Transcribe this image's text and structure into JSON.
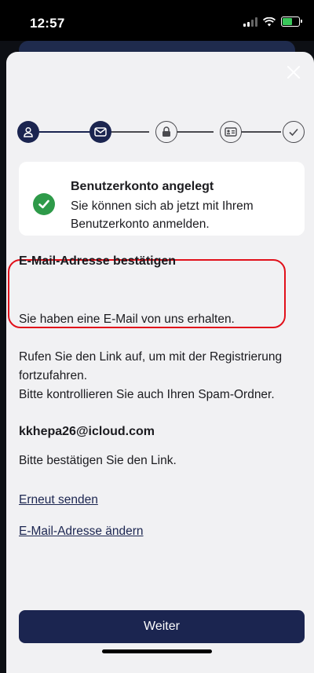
{
  "status_bar": {
    "time": "12:57"
  },
  "card": {
    "title": "Benutzerkonto angelegt",
    "text": "Sie können sich ab jetzt mit Ihrem Benutzerkonto anmelden."
  },
  "verify": {
    "title": "E-Mail-Adresse bestätigen",
    "received": "Sie haben eine E-Mail von uns erhalten.",
    "instructions_line1": "Rufen Sie den Link auf, um mit der Registrierung fortzufahren.",
    "instructions_line2": "Bitte kontrollieren Sie auch Ihren Spam-Ordner.",
    "email": "kkhepa26@icloud.com",
    "confirm": "Bitte bestätigen Sie den Link."
  },
  "links": {
    "resend": "Erneut senden",
    "change_email": "E-Mail-Adresse ändern"
  },
  "buttons": {
    "continue": "Weiter"
  },
  "stepper": {
    "steps": [
      "user-icon",
      "mail-icon",
      "lock-icon",
      "id-card-icon",
      "checkmark-icon"
    ],
    "current_step": 2
  },
  "colors": {
    "primary": "#1b2550",
    "success": "#2e9a49",
    "highlight": "#e1101a",
    "background": "#f1f1f3"
  }
}
